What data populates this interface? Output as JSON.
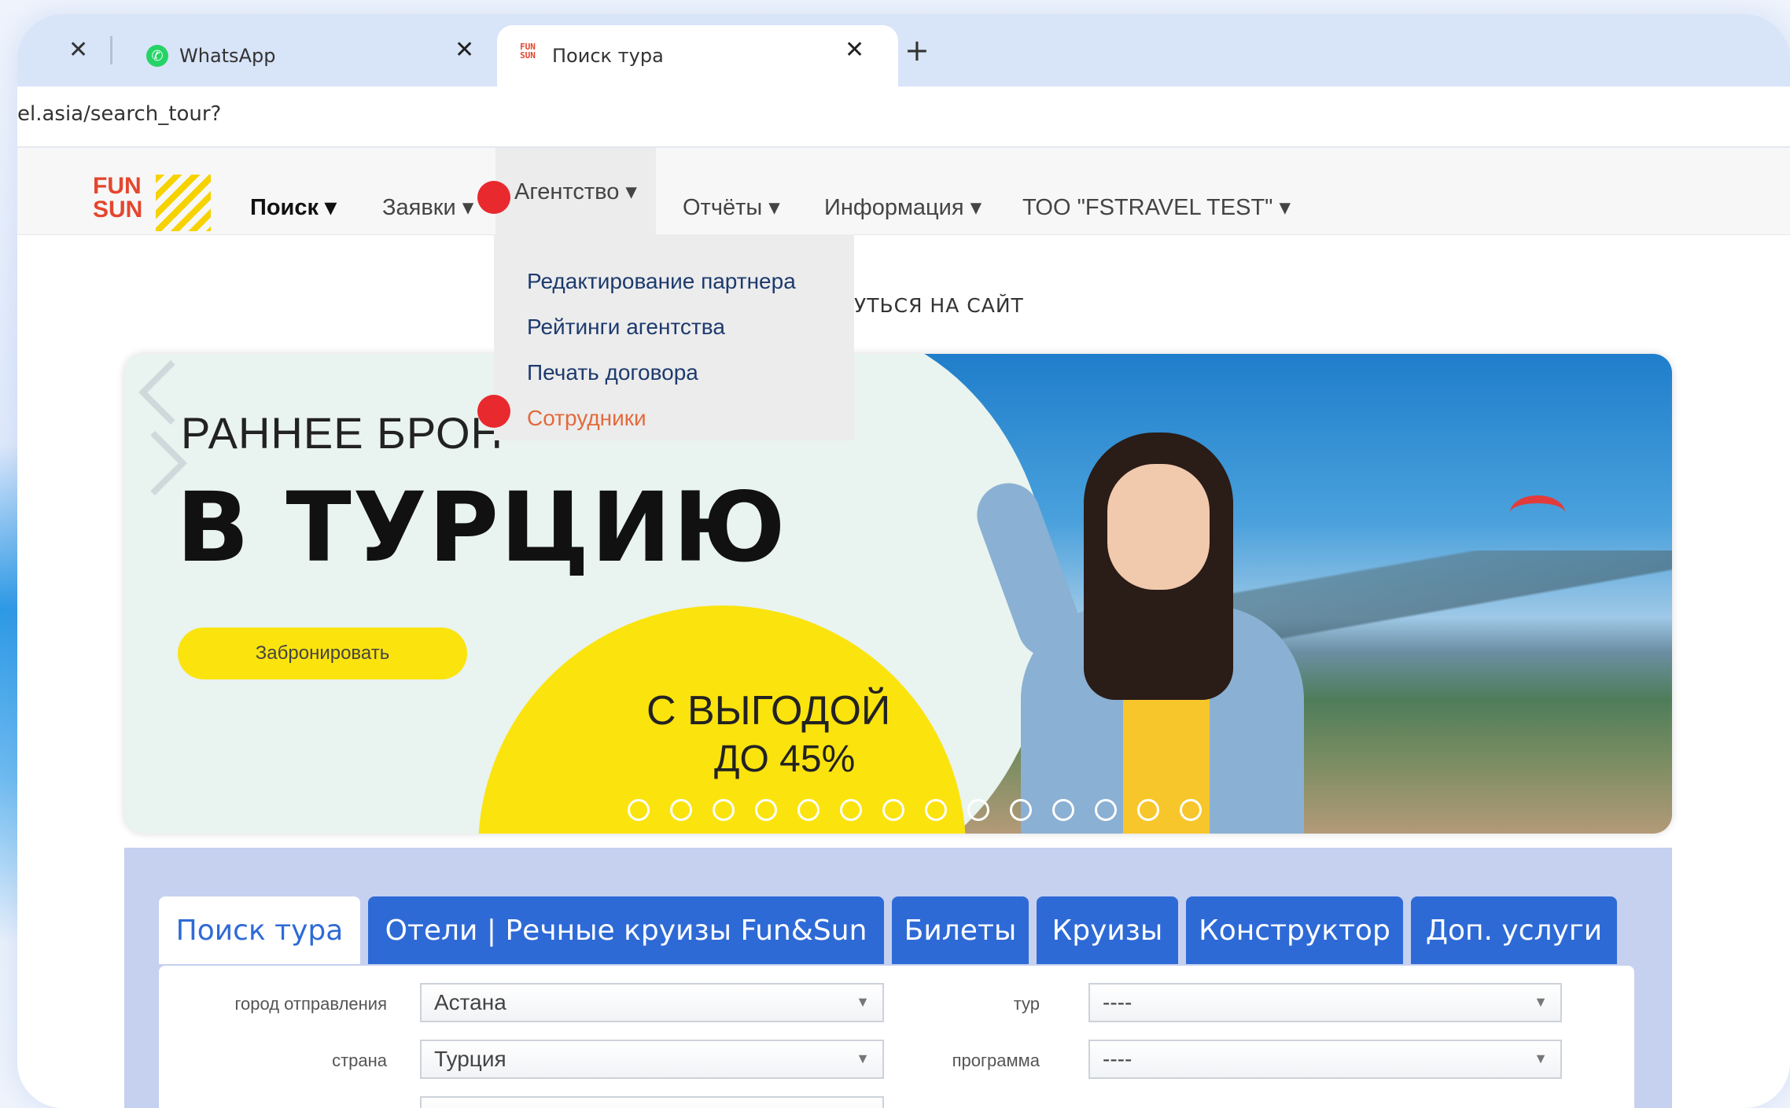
{
  "browser": {
    "tabs": [
      {
        "label": "WhatsApp"
      },
      {
        "label": "Поиск тура",
        "favicon_text": "FUN SUN"
      }
    ],
    "url": "el.asia/search_tour?"
  },
  "site_nav": {
    "logo_text": "FUN&SUN",
    "items": [
      {
        "label": "Поиск ▾"
      },
      {
        "label": "Заявки ▾"
      },
      {
        "label": "Агентство ▾"
      },
      {
        "label": "Отчёты ▾"
      },
      {
        "label": "Информация ▾"
      },
      {
        "label": "ТОО \"FSTRAVEL TEST\" ▾"
      }
    ]
  },
  "dropdown": {
    "items": [
      {
        "label": "Редактирование партнера"
      },
      {
        "label": "Рейтинги агентства"
      },
      {
        "label": "Печать договора"
      },
      {
        "label": "Сотрудники"
      }
    ],
    "return_text": "УТЬСЯ НА САЙТ"
  },
  "banner": {
    "line1": "РАННЕЕ БРОН",
    "line2": "В ТУРЦИЮ",
    "button": "Забронировать",
    "promo_line1": "С ВЫГОДОЙ",
    "promo_line2": "ДО 45%",
    "slide_count": 14
  },
  "search": {
    "tabs": [
      {
        "label": "Поиск тура"
      },
      {
        "label": "Отели | Речные круизы Fun&Sun"
      },
      {
        "label": "Билеты"
      },
      {
        "label": "Круизы"
      },
      {
        "label": "Конструктор"
      },
      {
        "label": "Доп. услуги"
      }
    ],
    "fields": {
      "departure_label": "город отправления",
      "departure_value": "Астана",
      "country_label": "страна",
      "country_value": "Турция",
      "tour_label": "тур",
      "tour_value": "----",
      "program_label": "программа",
      "program_value": "----"
    }
  },
  "colors": {
    "accent_blue": "#2e6ad6",
    "marker_red": "#e8292e",
    "brand_yellow": "#fbe30e",
    "highlight_orange": "#e26a3c"
  }
}
